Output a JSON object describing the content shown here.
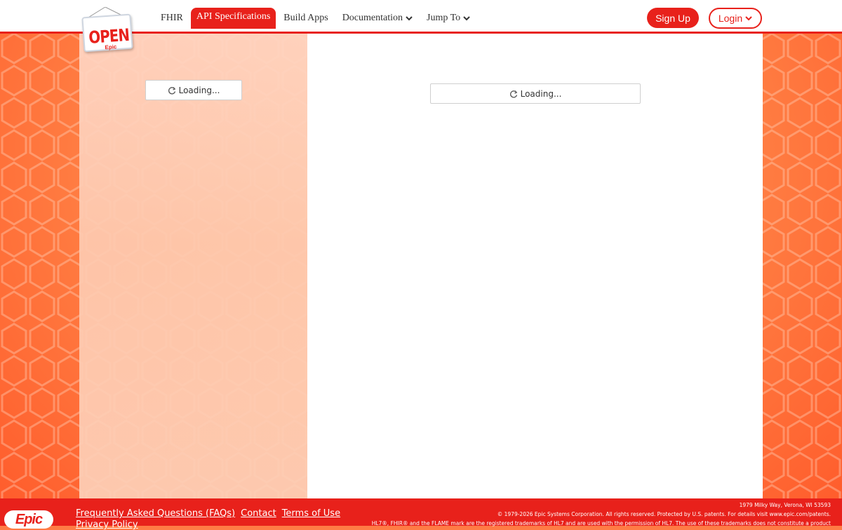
{
  "nav": {
    "items": [
      {
        "label": "FHIR",
        "active": false,
        "dropdown": false
      },
      {
        "label": "API Specifications",
        "active": true,
        "dropdown": false
      },
      {
        "label": "Build Apps",
        "active": false,
        "dropdown": false
      },
      {
        "label": "Documentation",
        "active": false,
        "dropdown": true
      },
      {
        "label": "Jump To",
        "active": false,
        "dropdown": true
      }
    ]
  },
  "logo": {
    "main": "OPEN",
    "sub": "Epic"
  },
  "auth": {
    "signup_label": "Sign Up",
    "login_label": "Login"
  },
  "sidebar": {
    "loading_text": "Loading..."
  },
  "main": {
    "loading_text": "Loading..."
  },
  "footer": {
    "brand": "Epic",
    "links": [
      "Frequently Asked Questions (FAQs)",
      "Contact",
      "Terms of Use"
    ],
    "link_overflow": "Privacy Policy",
    "address": "1979 Milky Way, Verona, WI 53593",
    "copyright": "© 1979-2026 Epic Systems Corporation. All rights reserved. Protected by U.S. patents. For details visit www.epic.com/patents.",
    "trademark": "HL7®, FHIR® and the FLAME mark are the registered trademarks of HL7 and are used with the permission of HL7. The use of these trademarks does not constitute a product"
  },
  "colors": {
    "accent": "#e8211b",
    "background": "#ff7b45"
  }
}
